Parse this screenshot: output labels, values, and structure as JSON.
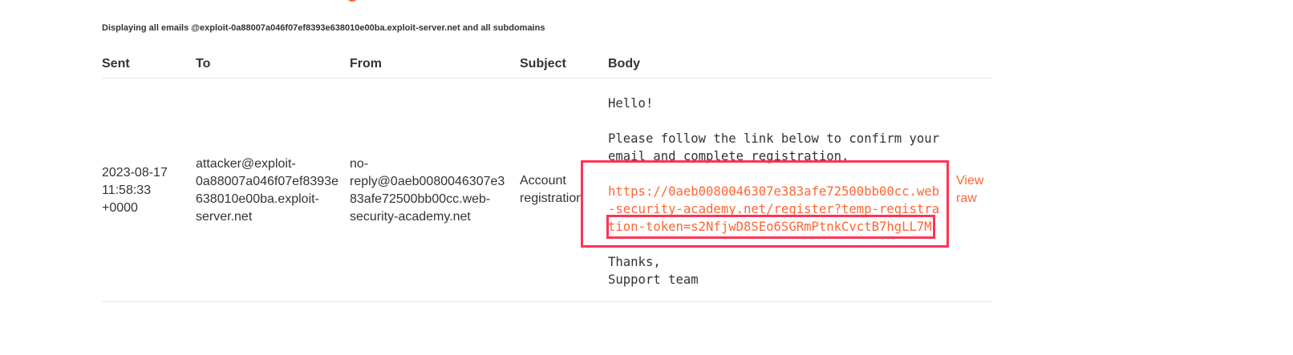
{
  "info_text": "Displaying all emails @exploit-0a88007a046f07ef8393e638010e00ba.exploit-server.net and all subdomains",
  "headers": {
    "sent": "Sent",
    "to": "To",
    "from": "From",
    "subject": "Subject",
    "body": "Body"
  },
  "emails": [
    {
      "sent": [
        "2023-08-17",
        "11:58:33",
        "+0000"
      ],
      "to": [
        "attacker@exploit-",
        "0a88007a046f07ef8393e",
        "638010e00ba.exploit-",
        "server.net"
      ],
      "from": [
        "no-",
        "reply@0aeb0080046307e3",
        "83afe72500bb00cc.web-",
        "security-academy.net"
      ],
      "subject": [
        "Account",
        "registration"
      ],
      "body": {
        "greeting": "Hello!",
        "instructions": [
          "Please follow the link below to confirm your",
          "email and complete registration."
        ],
        "link": [
          "https://0aeb0080046307e383afe72500bb00cc.web",
          "-security-academy.net/register?temp-registra",
          "tion-token=s2NfjwD8SEo6SGRmPtnkCvctB7hgLL7M"
        ],
        "signoff": [
          "Thanks,",
          "Support team"
        ]
      },
      "view_raw": [
        "View",
        "raw"
      ]
    }
  ],
  "colors": {
    "link": "#ff6633",
    "highlight": "#ff3355",
    "text": "#333333"
  }
}
